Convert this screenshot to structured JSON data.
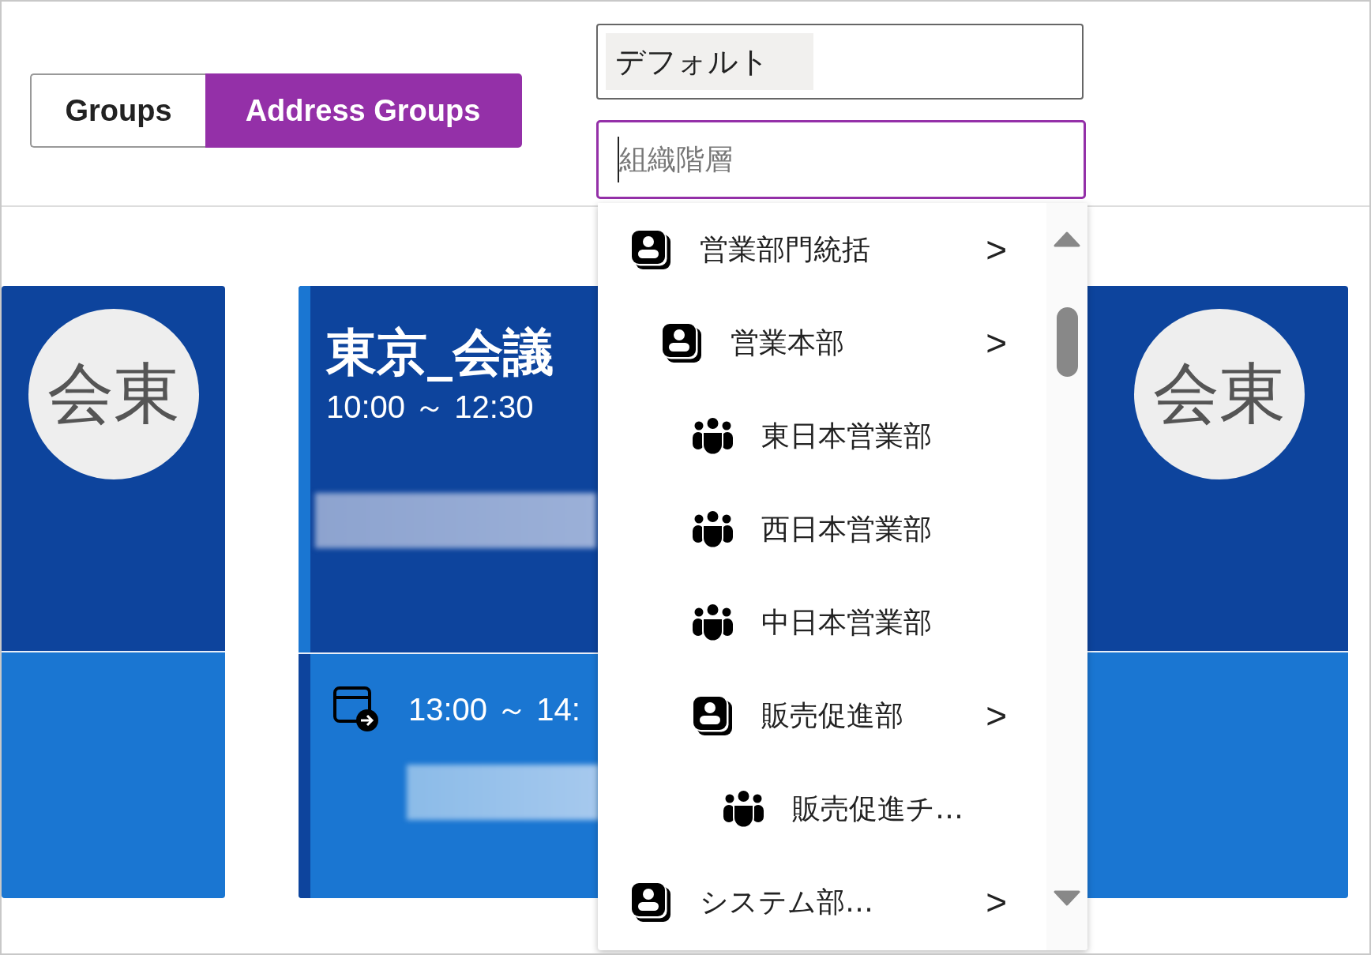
{
  "view_toggle": [
    {
      "label": "Groups",
      "selected": false
    },
    {
      "label": "Address Groups",
      "selected": true
    }
  ],
  "group_select": {
    "value": "デフォルト"
  },
  "hierarchy_search": {
    "placeholder": "組織階層"
  },
  "hierarchy_dropdown": {
    "items": [
      {
        "kind": "unit",
        "label": "営業部門統括",
        "chevron": ">",
        "children": [
          {
            "kind": "unit",
            "label": "営業本部",
            "chevron": ">",
            "children": [
              {
                "kind": "team",
                "label": "東日本営業部"
              },
              {
                "kind": "team",
                "label": "西日本営業部"
              },
              {
                "kind": "team",
                "label": "中日本営業部"
              },
              {
                "kind": "unit",
                "label": "販売促進部",
                "chevron": ">",
                "children": [
                  {
                    "kind": "team",
                    "label": "販売促進チ…"
                  }
                ]
              }
            ]
          }
        ]
      },
      {
        "kind": "unit",
        "label": "システム部…",
        "chevron": ">"
      }
    ]
  },
  "room_cards": [
    {
      "kind": "avatar",
      "avatar": "会東"
    },
    {
      "kind": "schedule",
      "current": {
        "title": "東京_会議",
        "time": "10:00 ～ 12:30"
      },
      "next": {
        "time": "13:00 ～ 14:"
      }
    },
    {
      "kind": "avatar",
      "avatar": "会東"
    }
  ]
}
